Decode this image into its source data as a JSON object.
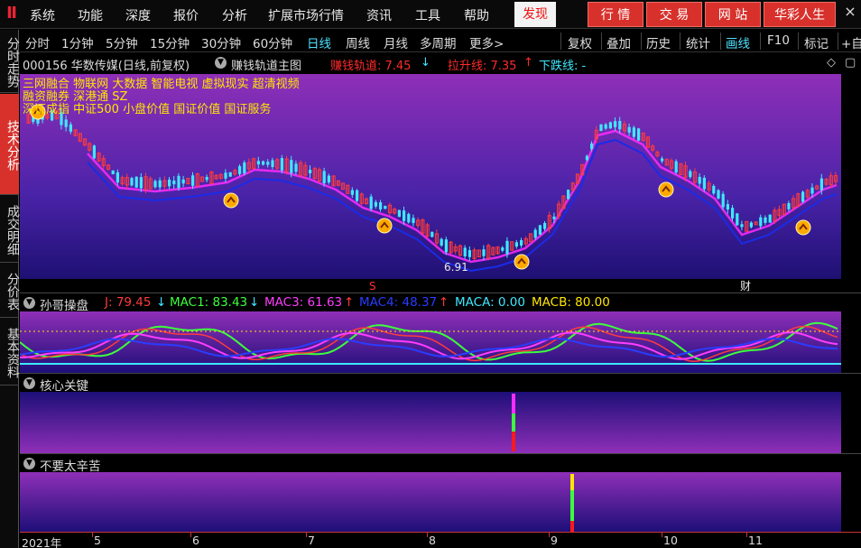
{
  "app": {
    "logo": "Ⅱ",
    "menu": [
      "系统",
      "功能",
      "深度",
      "报价",
      "分析",
      "扩展市场行情",
      "资讯",
      "工具",
      "帮助"
    ],
    "discover": "发现",
    "red_buttons": [
      "行 情",
      "交 易",
      "网 站",
      "华彩人生"
    ],
    "window_controls": [
      "—",
      "×"
    ]
  },
  "left_tabs": [
    {
      "label": "分时走势",
      "active": false
    },
    {
      "label": "技术分析",
      "active": true
    },
    {
      "label": "成交明细",
      "active": false
    },
    {
      "label": "分价表",
      "active": false
    },
    {
      "label": "基本资料",
      "active": false
    }
  ],
  "periods": [
    {
      "label": "分时",
      "active": false
    },
    {
      "label": "1分钟",
      "active": false
    },
    {
      "label": "5分钟",
      "active": false
    },
    {
      "label": "15分钟",
      "active": false
    },
    {
      "label": "30分钟",
      "active": false
    },
    {
      "label": "60分钟",
      "active": false
    },
    {
      "label": "日线",
      "active": true
    },
    {
      "label": "周线",
      "active": false
    },
    {
      "label": "月线",
      "active": false
    },
    {
      "label": "多周期",
      "active": false
    },
    {
      "label": "更多>",
      "active": false
    }
  ],
  "tools": [
    {
      "label": "复权",
      "active": false
    },
    {
      "label": "叠加",
      "active": false
    },
    {
      "label": "历史",
      "active": false
    },
    {
      "label": "统计",
      "active": false
    },
    {
      "label": "画线",
      "active": true
    },
    {
      "label": "F10",
      "active": false
    },
    {
      "label": "标记",
      "active": false
    },
    {
      "label": "+自",
      "active": false
    }
  ],
  "info": {
    "stock": "000156 华数传媒(日线,前复权)",
    "indicator": "赚钱轨道主图",
    "line1_label": "赚钱轨道: 7.45",
    "line1_arrow": "↓",
    "line2_label": "拉升线: 7.35",
    "line2_arrow": "↑",
    "line3_label": "下跌线: -",
    "controls": [
      "◇",
      "▢"
    ]
  },
  "concepts": {
    "line1": "三网融合 物联网 大数据 智能电视 虚拟现实 超清视频",
    "line2": "融资融券 深港通 SZ",
    "line3": "深证成指 中证500 小盘价值 国证价值 国证服务"
  },
  "main_labels": {
    "low_price": "6.91",
    "marker_s": "S",
    "marker_cai": "财"
  },
  "sub1": {
    "title": "孙哥操盘",
    "j": "J: 79.45",
    "j_arrow": "↓",
    "mac1": "MAC1: 83.43",
    "mac1_arrow": "↓",
    "mac3": "MAC3: 61.63",
    "mac3_arrow": "↑",
    "mac4": "MAC4: 48.37",
    "mac4_arrow": "↑",
    "maca": "MACA: 0.00",
    "macb": "MACB: 80.00"
  },
  "sub2": {
    "title": "核心关键"
  },
  "sub3": {
    "title": "不要太辛苦"
  },
  "dates": [
    "2021年",
    "5",
    "6",
    "7",
    "8",
    "9",
    "10",
    "11"
  ],
  "colors": {
    "up": "#ff3b3b",
    "down": "#3fe8ff",
    "money_track": "#ff2cff",
    "rise_line": "#1a2be8",
    "accent_yellow": "#ffe600",
    "tab_red": "#d8312c"
  },
  "chart_data": {
    "type": "candlestick",
    "series": [
      {
        "name": "赚钱轨道",
        "last": 7.45
      },
      {
        "name": "拉升线",
        "last": 7.35
      }
    ],
    "low_marked": 6.91,
    "months": [
      "5",
      "6",
      "7",
      "8",
      "9",
      "10",
      "11"
    ]
  }
}
